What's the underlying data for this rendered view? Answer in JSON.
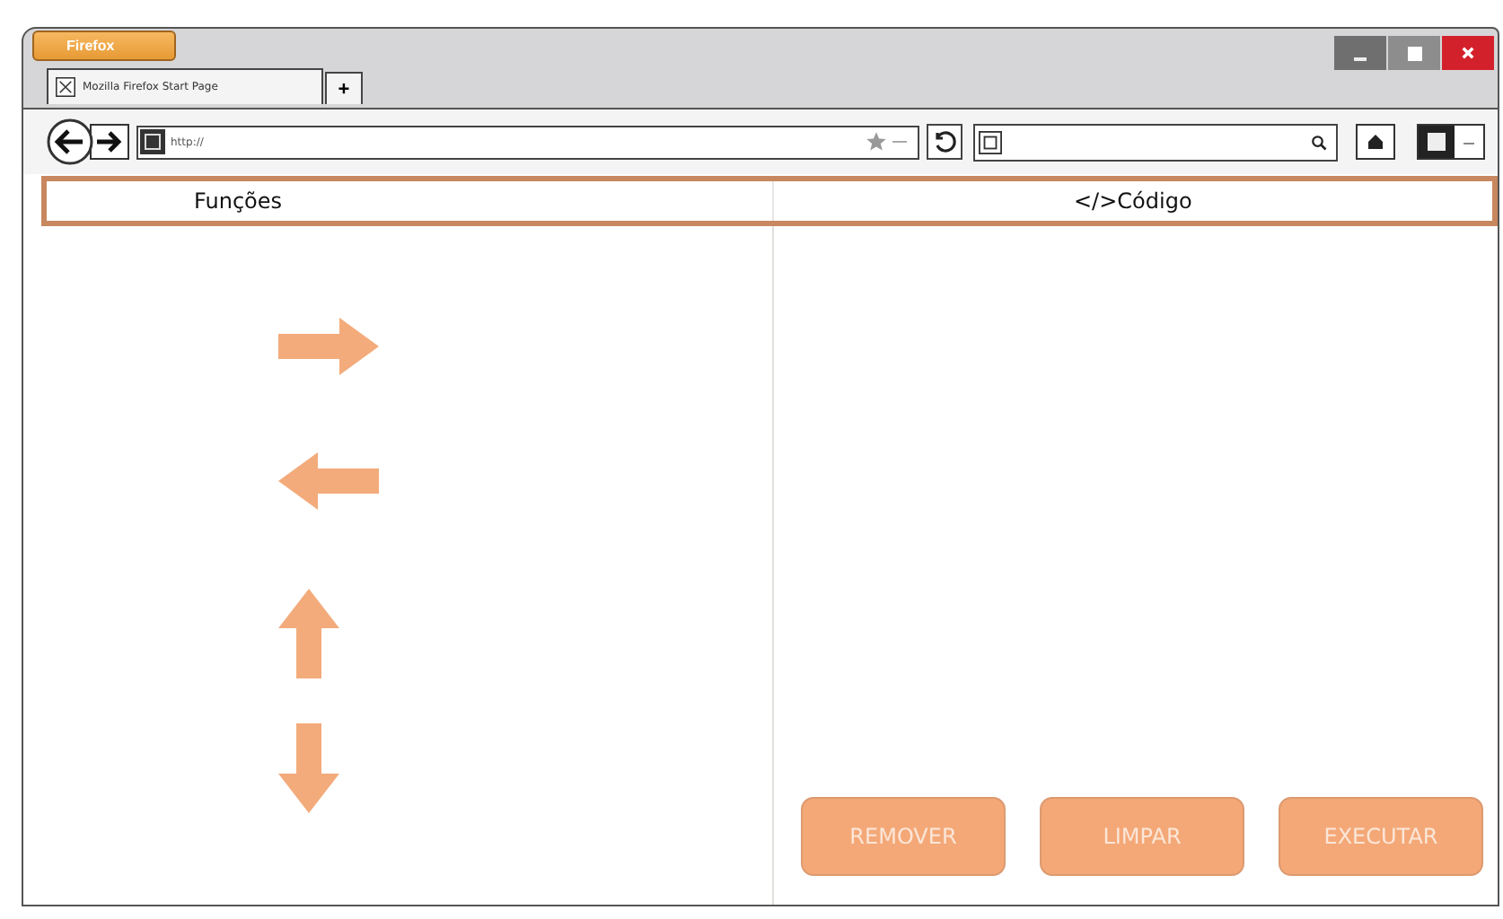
{
  "window": {
    "menu_button": "Firefox"
  },
  "tabs": [
    {
      "label": "Mozilla Firefox Start Page",
      "selected": true
    }
  ],
  "new_tab": "+",
  "address_bar": {
    "value": "http://"
  },
  "columns": [
    {
      "title": "Funções"
    },
    {
      "title": "</>Código"
    }
  ],
  "functions": [
    {
      "kind": "right"
    },
    {
      "kind": "left"
    },
    {
      "kind": "up"
    },
    {
      "kind": "down"
    }
  ],
  "buttons": [
    {
      "label": "REMOVER"
    },
    {
      "label": "LIMPAR"
    },
    {
      "label": "EXECUTAR"
    }
  ]
}
